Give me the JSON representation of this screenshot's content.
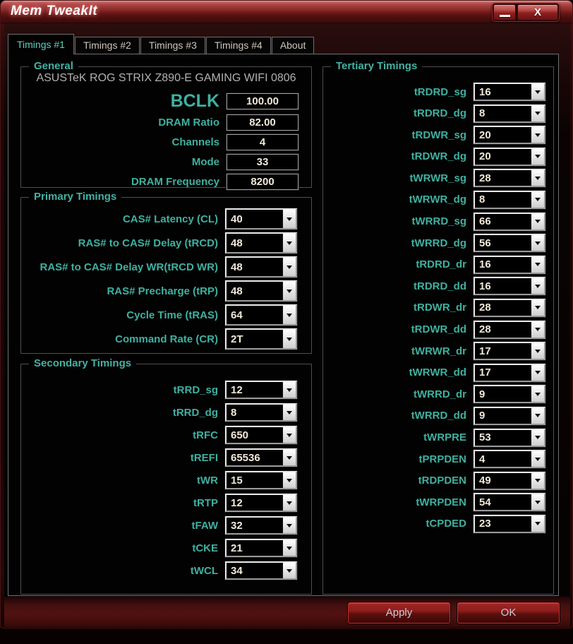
{
  "window": {
    "title": "Mem TweakIt",
    "close_glyph": "X"
  },
  "tabs": [
    {
      "label": "Timings #1",
      "active": true
    },
    {
      "label": "Timings #2",
      "active": false
    },
    {
      "label": "Timings #3",
      "active": false
    },
    {
      "label": "Timings #4",
      "active": false
    },
    {
      "label": "About",
      "active": false
    }
  ],
  "general": {
    "legend": "General",
    "board": "ASUSTeK ROG STRIX Z890-E GAMING WIFI 0806",
    "fields": [
      {
        "label": "BCLK",
        "value": "100.00"
      },
      {
        "label": "DRAM Ratio",
        "value": "82.00"
      },
      {
        "label": "Channels",
        "value": "4"
      },
      {
        "label": "Mode",
        "value": "33"
      },
      {
        "label": "DRAM Frequency",
        "value": "8200"
      }
    ]
  },
  "primary": {
    "legend": "Primary Timings",
    "rows": [
      {
        "label": "CAS# Latency (CL)",
        "value": "40"
      },
      {
        "label": "RAS# to CAS# Delay (tRCD)",
        "value": "48"
      },
      {
        "label": "RAS# to CAS# Delay WR(tRCD WR)",
        "value": "48"
      },
      {
        "label": "RAS# Precharge (tRP)",
        "value": "48"
      },
      {
        "label": "Cycle Time (tRAS)",
        "value": "64"
      },
      {
        "label": "Command Rate (CR)",
        "value": "2T"
      }
    ]
  },
  "secondary": {
    "legend": "Secondary Timings",
    "rows": [
      {
        "label": "tRRD_sg",
        "value": "12"
      },
      {
        "label": "tRRD_dg",
        "value": "8"
      },
      {
        "label": "tRFC",
        "value": "650"
      },
      {
        "label": "tREFI",
        "value": "65536"
      },
      {
        "label": "tWR",
        "value": "15"
      },
      {
        "label": "tRTP",
        "value": "12"
      },
      {
        "label": "tFAW",
        "value": "32"
      },
      {
        "label": "tCKE",
        "value": "21"
      },
      {
        "label": "tWCL",
        "value": "34"
      }
    ]
  },
  "tertiary": {
    "legend": "Tertiary Timings",
    "rows": [
      {
        "label": "tRDRD_sg",
        "value": "16"
      },
      {
        "label": "tRDRD_dg",
        "value": "8"
      },
      {
        "label": "tRDWR_sg",
        "value": "20"
      },
      {
        "label": "tRDWR_dg",
        "value": "20"
      },
      {
        "label": "tWRWR_sg",
        "value": "28"
      },
      {
        "label": "tWRWR_dg",
        "value": "8"
      },
      {
        "label": "tWRRD_sg",
        "value": "66"
      },
      {
        "label": "tWRRD_dg",
        "value": "56"
      },
      {
        "label": "tRDRD_dr",
        "value": "16"
      },
      {
        "label": "tRDRD_dd",
        "value": "16"
      },
      {
        "label": "tRDWR_dr",
        "value": "28"
      },
      {
        "label": "tRDWR_dd",
        "value": "28"
      },
      {
        "label": "tWRWR_dr",
        "value": "17"
      },
      {
        "label": "tWRWR_dd",
        "value": "17"
      },
      {
        "label": "tWRRD_dr",
        "value": "9"
      },
      {
        "label": "tWRRD_dd",
        "value": "9"
      },
      {
        "label": "tWRPRE",
        "value": "53"
      },
      {
        "label": "tPRPDEN",
        "value": "4"
      },
      {
        "label": "tRDPDEN",
        "value": "49"
      },
      {
        "label": "tWRPDEN",
        "value": "54"
      },
      {
        "label": "tCPDED",
        "value": "23"
      }
    ]
  },
  "footer": {
    "apply_label": "Apply",
    "ok_label": "OK"
  },
  "colors": {
    "accent_teal": "#40b0a0",
    "title_red": "#a84140",
    "button_red": "#8c1d1b",
    "value_text": "#f2e9d9",
    "inactive_tab_text": "#cfc5b8"
  }
}
